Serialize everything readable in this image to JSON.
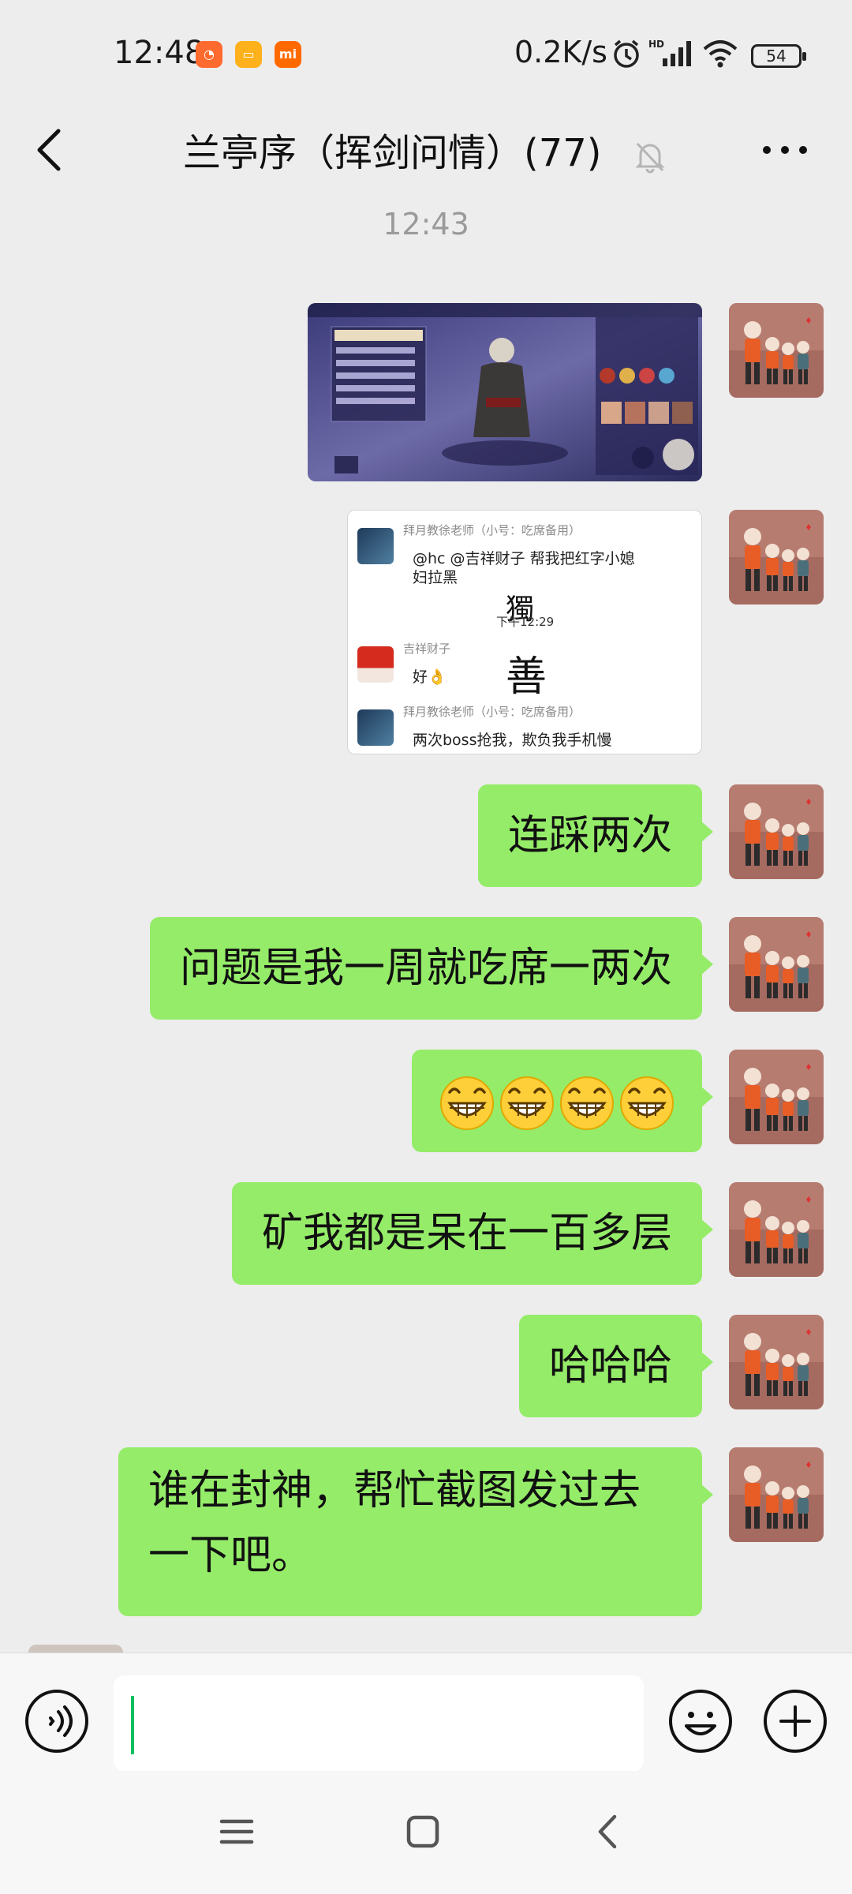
{
  "status_bar": {
    "time": "12:48",
    "network_speed": "0.2K/s",
    "battery": "54",
    "icons": [
      "app-icon-orange",
      "app-icon-yellow",
      "app-icon-mi",
      "alarm-icon",
      "hd-signal-icon",
      "wifi-icon",
      "battery-icon"
    ]
  },
  "header": {
    "title": "兰亭序（挥剑问情）(77)",
    "icons": [
      "back-arrow-icon",
      "mute-bell-icon",
      "more-dots-icon"
    ]
  },
  "chat": {
    "timestamp": "12:43",
    "screenshot2": {
      "msg1_name": "拜月教徐老师（小号：吃席备用）",
      "msg1_text_line1": "@hc @吉祥财子 帮我把红字小媳",
      "msg1_text_line2": "妇拉黑",
      "sticker_top": "獨",
      "msg_time": "下午12:29",
      "msg2_name": "吉祥财子",
      "msg2_text": "好👌",
      "sticker_bottom": "善",
      "msg3_name": "拜月教徐老师（小号：吃席备用）",
      "msg3_text": "两次boss抢我，欺负我手机慢"
    },
    "messages": [
      {
        "text": "连踩两次"
      },
      {
        "text": "问题是我一周就吃席一两次"
      },
      {
        "text": ""
      },
      {
        "text": "矿我都是呆在一百多层"
      },
      {
        "text": "哈哈哈"
      },
      {
        "text": "谁在封神，帮忙截图发过去一下吧。"
      }
    ],
    "emoji_count": 4
  },
  "input_bar": {
    "value": "",
    "icons": [
      "voice-icon",
      "emoji-icon",
      "plus-icon"
    ]
  },
  "system_nav": {
    "icons": [
      "menu-icon",
      "home-icon",
      "back-icon"
    ]
  },
  "colors": {
    "bubble": "#95ec69",
    "background": "#ededed",
    "accent": "#07c160"
  }
}
